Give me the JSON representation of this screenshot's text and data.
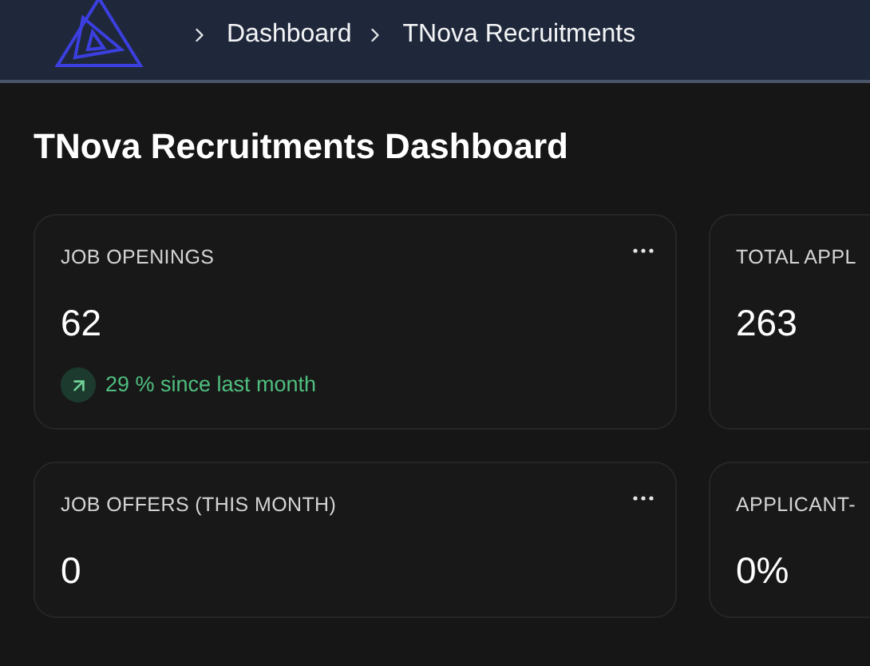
{
  "breadcrumb": [
    {
      "label": "Dashboard"
    },
    {
      "label": "TNova Recruitments"
    }
  ],
  "page_title": "TNova Recruitments Dashboard",
  "cards": [
    {
      "label": "JOB OPENINGS",
      "value": "62",
      "menu": true,
      "trend": {
        "kind": "up",
        "text": "29 % since last month"
      }
    },
    {
      "label": "TOTAL APPL",
      "value": "263"
    },
    {
      "label": "JOB OFFERS (THIS MONTH)",
      "value": "0",
      "menu": true
    },
    {
      "label": "APPLICANT-",
      "value": "0%"
    }
  ]
}
